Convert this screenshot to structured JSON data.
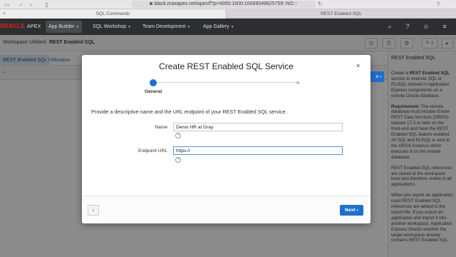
{
  "browser": {
    "url": "black.maxapex.net/apex/f?p=4000:1600:10069049625759::NO:::",
    "tabs": [
      "SQL Commands",
      "REST Enabled SQL"
    ]
  },
  "apex": {
    "logo_oracle": "ORACLE",
    "logo_apex": "APEX",
    "menu": [
      "App Builder",
      "SQL Workshop",
      "Team Development",
      "App Gallery"
    ]
  },
  "page": {
    "breadcrumb": [
      "Workspace Utilities",
      "REST Enabled SQL"
    ],
    "breadcrumb_sep": "\\",
    "sub_tabs": [
      "REST Enabled SQL",
      "Utilization"
    ],
    "badge_count": "1",
    "peek_button": "e"
  },
  "side_panel": {
    "title": "REST Enabled SQL",
    "p1_pre": "Create a ",
    "p1_bold": "REST Enabled SQL",
    "p1_post": " service to execute SQL or PL/SQL defined in Application Express components on a remote Oracle database.",
    "p2_bold": "Requirement:",
    "p2_post": " The remote database must include Oracle REST Data Services (ORDS) release 17.3 or later on the front-end and have the REST Enabled SQL feature enabled. All SQL and PL/SQL is sent to the ORDS instance which executes it on the remote database.",
    "p3": "REST Enabled SQL references are stored at the workspace level and therefore visible in all applications.",
    "p4": "When you export an application, used REST Enabled SQL references are added to the export file. If you export an application and import it into another workspace, Application Express checks whether the target workspace already contains REST Enabled SQL"
  },
  "dialog": {
    "title": "Create REST Enabled SQL Service",
    "step_label": "General",
    "description": "Provide a descriptive name and the URL endpoint of your REST Enabled SQL service.",
    "name_label": "Name",
    "name_value": "Demo HR at Gray",
    "endpoint_label": "Endpoint URL",
    "endpoint_value": "https://",
    "help_glyph": "?",
    "next_label": "Next"
  }
}
